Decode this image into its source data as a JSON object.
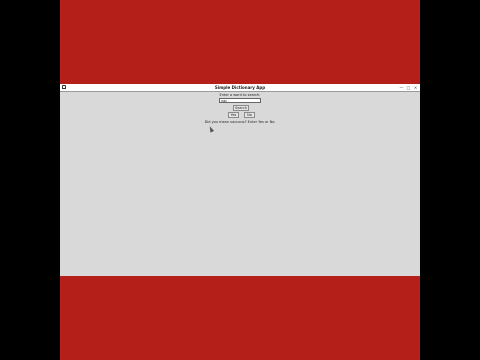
{
  "window": {
    "title": "Simple Dictionary App",
    "controls": {
      "minimize": "—",
      "maximize": "□",
      "close": "×"
    }
  },
  "app": {
    "prompt": "Enter a word to search:",
    "entry_value": "vac",
    "search_label": "Search",
    "yes_label": "Yes",
    "no_label": "No",
    "suggestion": "Did you mean vacuous? Enter Yes or No."
  },
  "colors": {
    "desktop": "#b51f1a",
    "window_bg": "#d9d9d9"
  }
}
